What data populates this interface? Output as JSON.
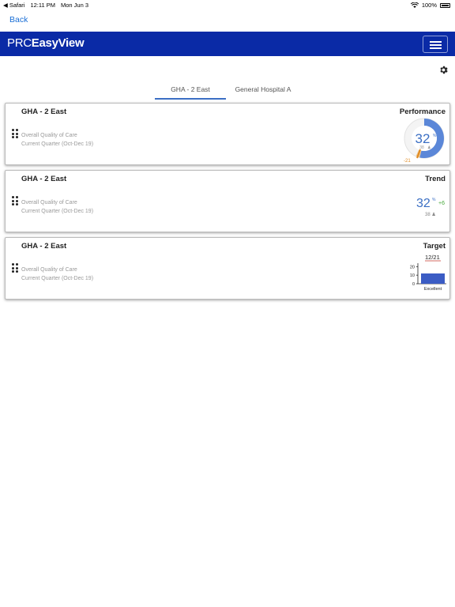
{
  "status_bar": {
    "carrier": "◀ Safari",
    "time": "12:11 PM",
    "date": "Mon Jun 3",
    "battery": "100%"
  },
  "nav": {
    "back_label": "Back",
    "brand_part1": "PRC",
    "brand_part2": "EasyView"
  },
  "tabs": [
    {
      "label": "GHA - 2 East",
      "active": true
    },
    {
      "label": "General Hospital A",
      "active": false
    }
  ],
  "cards": [
    {
      "title": "GHA - 2 East",
      "type": "Performance",
      "line1": "Overall Quality of Care",
      "line2": "Current Quarter (Oct-Dec 19)",
      "value": "32",
      "unit": "%",
      "count": "38",
      "delta": "-21",
      "colors": {
        "good": "#5b87d8",
        "bad": "#edc48c",
        "marker": "#e08a20"
      }
    },
    {
      "title": "GHA - 2 East",
      "type": "Trend",
      "line1": "Overall Quality of Care",
      "line2": "Current Quarter (Oct-Dec 19)",
      "value": "32",
      "unit": "%",
      "delta": "+6",
      "count": "38"
    },
    {
      "title": "GHA - 2 East",
      "type": "Target",
      "line1": "Overall Quality of Care",
      "line2": "Current Quarter (Oct-Dec 19)",
      "chart_label": "12/21"
    }
  ],
  "chart_data": {
    "type": "bar",
    "categories": [
      "Excellent"
    ],
    "values": [
      12
    ],
    "target": 21,
    "yticks": [
      "0",
      "10",
      "20"
    ],
    "ylim": [
      0,
      24
    ],
    "bar_color": "#3b5cc4",
    "target_color": "#c0392b"
  }
}
